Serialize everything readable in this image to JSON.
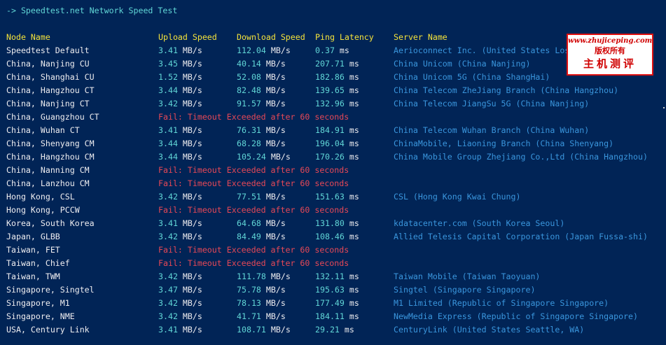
{
  "title": "-> Speedtest.net Network Speed Test",
  "headers": {
    "node": "Node Name",
    "upload": "Upload Speed",
    "download": "Download Speed",
    "ping": "Ping Latency",
    "server": "Server Name"
  },
  "rows": [
    {
      "node": "Speedtest Default",
      "up": "3.41",
      "up_unit": "MB/s",
      "down": "112.04",
      "down_unit": "MB/s",
      "ping": "0.37",
      "ping_unit": "ms",
      "server": "Aerioconnect Inc. (United States Los Angeles, CA)"
    },
    {
      "node": "China, Nanjing CU",
      "up": "3.45",
      "up_unit": "MB/s",
      "down": "40.14",
      "down_unit": "MB/s",
      "ping": "207.71",
      "ping_unit": "ms",
      "server": "China Unicom (China Nanjing)"
    },
    {
      "node": "China, Shanghai CU",
      "up": "1.52",
      "up_unit": "MB/s",
      "down": "52.08",
      "down_unit": "MB/s",
      "ping": "182.86",
      "ping_unit": "ms",
      "server": "China Unicom 5G (China ShangHai)"
    },
    {
      "node": "China, Hangzhou CT",
      "up": "3.44",
      "up_unit": "MB/s",
      "down": "82.48",
      "down_unit": "MB/s",
      "ping": "139.65",
      "ping_unit": "ms",
      "server": "China Telecom ZheJiang Branch (China Hangzhou)"
    },
    {
      "node": "China, Nanjing CT",
      "up": "3.42",
      "up_unit": "MB/s",
      "down": "91.57",
      "down_unit": "MB/s",
      "ping": "132.96",
      "ping_unit": "ms",
      "server": "China Telecom JiangSu 5G (China Nanjing)"
    },
    {
      "node": "China, Guangzhou CT",
      "fail": "Fail: Timeout Exceeded after 60 seconds"
    },
    {
      "node": "China, Wuhan CT",
      "up": "3.41",
      "up_unit": "MB/s",
      "down": "76.31",
      "down_unit": "MB/s",
      "ping": "184.91",
      "ping_unit": "ms",
      "server": "China Telecom Wuhan Branch (China Wuhan)"
    },
    {
      "node": "China, Shenyang CM",
      "up": "3.44",
      "up_unit": "MB/s",
      "down": "68.28",
      "down_unit": "MB/s",
      "ping": "196.04",
      "ping_unit": "ms",
      "server": "ChinaMobile, Liaoning Branch (China Shenyang)"
    },
    {
      "node": "China, Hangzhou CM",
      "up": "3.44",
      "up_unit": "MB/s",
      "down": "105.24",
      "down_unit": "MB/s",
      "ping": "170.26",
      "ping_unit": "ms",
      "server": "China Mobile Group Zhejiang Co.,Ltd (China Hangzhou)"
    },
    {
      "node": "China, Nanning CM",
      "fail": "Fail: Timeout Exceeded after 60 seconds"
    },
    {
      "node": "China, Lanzhou CM",
      "fail": "Fail: Timeout Exceeded after 60 seconds"
    },
    {
      "node": "Hong Kong, CSL",
      "up": "3.42",
      "up_unit": "MB/s",
      "down": "77.51",
      "down_unit": "MB/s",
      "ping": "151.63",
      "ping_unit": "ms",
      "server": "CSL (Hong Kong Kwai Chung)"
    },
    {
      "node": "Hong Kong, PCCW",
      "fail": "Fail: Timeout Exceeded after 60 seconds"
    },
    {
      "node": "Korea, South Korea",
      "up": "3.41",
      "up_unit": "MB/s",
      "down": "64.68",
      "down_unit": "MB/s",
      "ping": "131.80",
      "ping_unit": "ms",
      "server": "kdatacenter.com (South Korea Seoul)"
    },
    {
      "node": "Japan, GLBB",
      "up": "3.42",
      "up_unit": "MB/s",
      "down": "84.49",
      "down_unit": "MB/s",
      "ping": "108.46",
      "ping_unit": "ms",
      "server": "Allied Telesis Capital Corporation (Japan Fussa-shi)"
    },
    {
      "node": "Taiwan, FET",
      "fail": "Fail: Timeout Exceeded after 60 seconds"
    },
    {
      "node": "Taiwan, Chief",
      "fail": "Fail: Timeout Exceeded after 60 seconds"
    },
    {
      "node": "Taiwan, TWM",
      "up": "3.42",
      "up_unit": "MB/s",
      "down": "111.78",
      "down_unit": "MB/s",
      "ping": "132.11",
      "ping_unit": "ms",
      "server": "Taiwan Mobile (Taiwan Taoyuan)"
    },
    {
      "node": "Singapore, Singtel",
      "up": "3.47",
      "up_unit": "MB/s",
      "down": "75.78",
      "down_unit": "MB/s",
      "ping": "195.63",
      "ping_unit": "ms",
      "server": "Singtel (Singapore Singapore)"
    },
    {
      "node": "Singapore, M1",
      "up": "3.42",
      "up_unit": "MB/s",
      "down": "78.13",
      "down_unit": "MB/s",
      "ping": "177.49",
      "ping_unit": "ms",
      "server": "M1 Limited (Republic of Singapore Singapore)"
    },
    {
      "node": "Singapore, NME",
      "up": "3.42",
      "up_unit": "MB/s",
      "down": "41.71",
      "down_unit": "MB/s",
      "ping": "184.11",
      "ping_unit": "ms",
      "server": "NewMedia Express (Republic of Singapore Singapore)"
    },
    {
      "node": "USA, Century Link",
      "up": "3.41",
      "up_unit": "MB/s",
      "down": "108.71",
      "down_unit": "MB/s",
      "ping": "29.21",
      "ping_unit": "ms",
      "server": "CenturyLink (United States Seattle, WA)"
    }
  ],
  "watermark": {
    "url": "www.zhujiceping.com",
    "sub": "版权所有",
    "main": "主机测评"
  },
  "colors": {
    "background": "#012456",
    "header": "#f5e33b",
    "value": "#61d6d6",
    "server": "#3a96dd",
    "fail": "#e74856",
    "text": "#eeedf0"
  }
}
